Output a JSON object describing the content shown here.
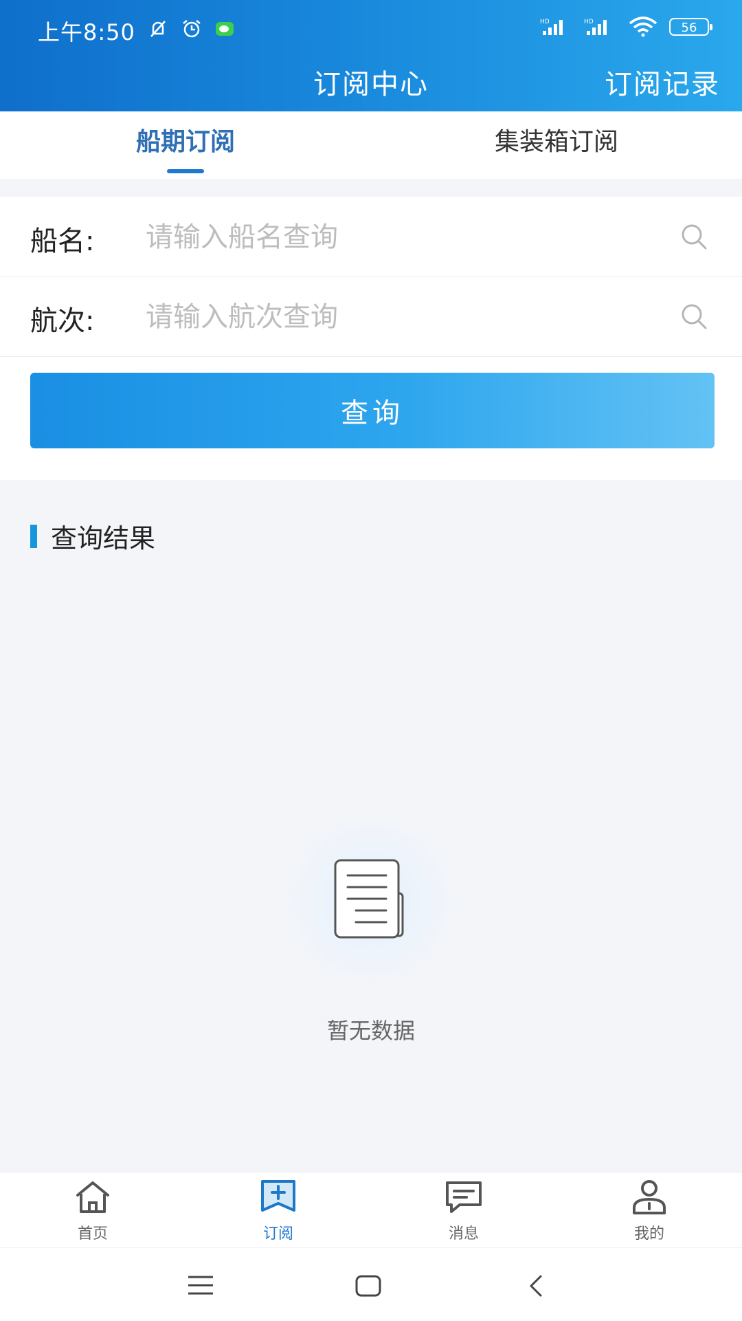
{
  "status": {
    "time": "上午8:50",
    "battery": "56"
  },
  "header": {
    "title": "订阅中心",
    "record_link": "订阅记录"
  },
  "tabs": [
    {
      "label": "船期订阅",
      "active": true
    },
    {
      "label": "集装箱订阅",
      "active": false
    }
  ],
  "form": {
    "ship_name": {
      "label": "船名:",
      "placeholder": "请输入船名查询"
    },
    "voyage": {
      "label": "航次:",
      "placeholder": "请输入航次查询"
    },
    "query_button": "查询"
  },
  "results": {
    "title": "查询结果",
    "empty_text": "暂无数据"
  },
  "bottom_nav": [
    {
      "label": "首页",
      "icon": "home-icon",
      "active": false
    },
    {
      "label": "订阅",
      "icon": "subscribe-icon",
      "active": true
    },
    {
      "label": "消息",
      "icon": "message-icon",
      "active": false
    },
    {
      "label": "我的",
      "icon": "profile-icon",
      "active": false
    }
  ],
  "colors": {
    "accent": "#1f78d1",
    "header_start": "#0f6fcb",
    "header_end": "#2aa8ec"
  }
}
